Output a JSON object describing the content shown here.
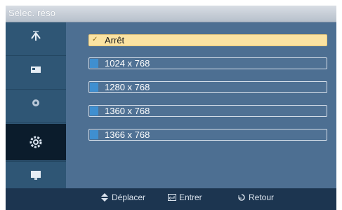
{
  "title": "Sélec. réso",
  "sidebar": {
    "items": [
      {
        "icon": "antenna-icon"
      },
      {
        "icon": "picture-icon"
      },
      {
        "icon": "sound-icon"
      },
      {
        "icon": "setup-gear-icon",
        "active": true
      },
      {
        "icon": "monitor-icon"
      }
    ]
  },
  "options": [
    {
      "label": "Arrêt",
      "selected": true
    },
    {
      "label": "1024 x 768",
      "selected": false
    },
    {
      "label": "1280 x 768",
      "selected": false
    },
    {
      "label": "1360 x 768",
      "selected": false
    },
    {
      "label": "1366 x 768",
      "selected": false
    }
  ],
  "footer": {
    "move_label": "Déplacer",
    "enter_label": "Entrer",
    "return_label": "Retour"
  }
}
